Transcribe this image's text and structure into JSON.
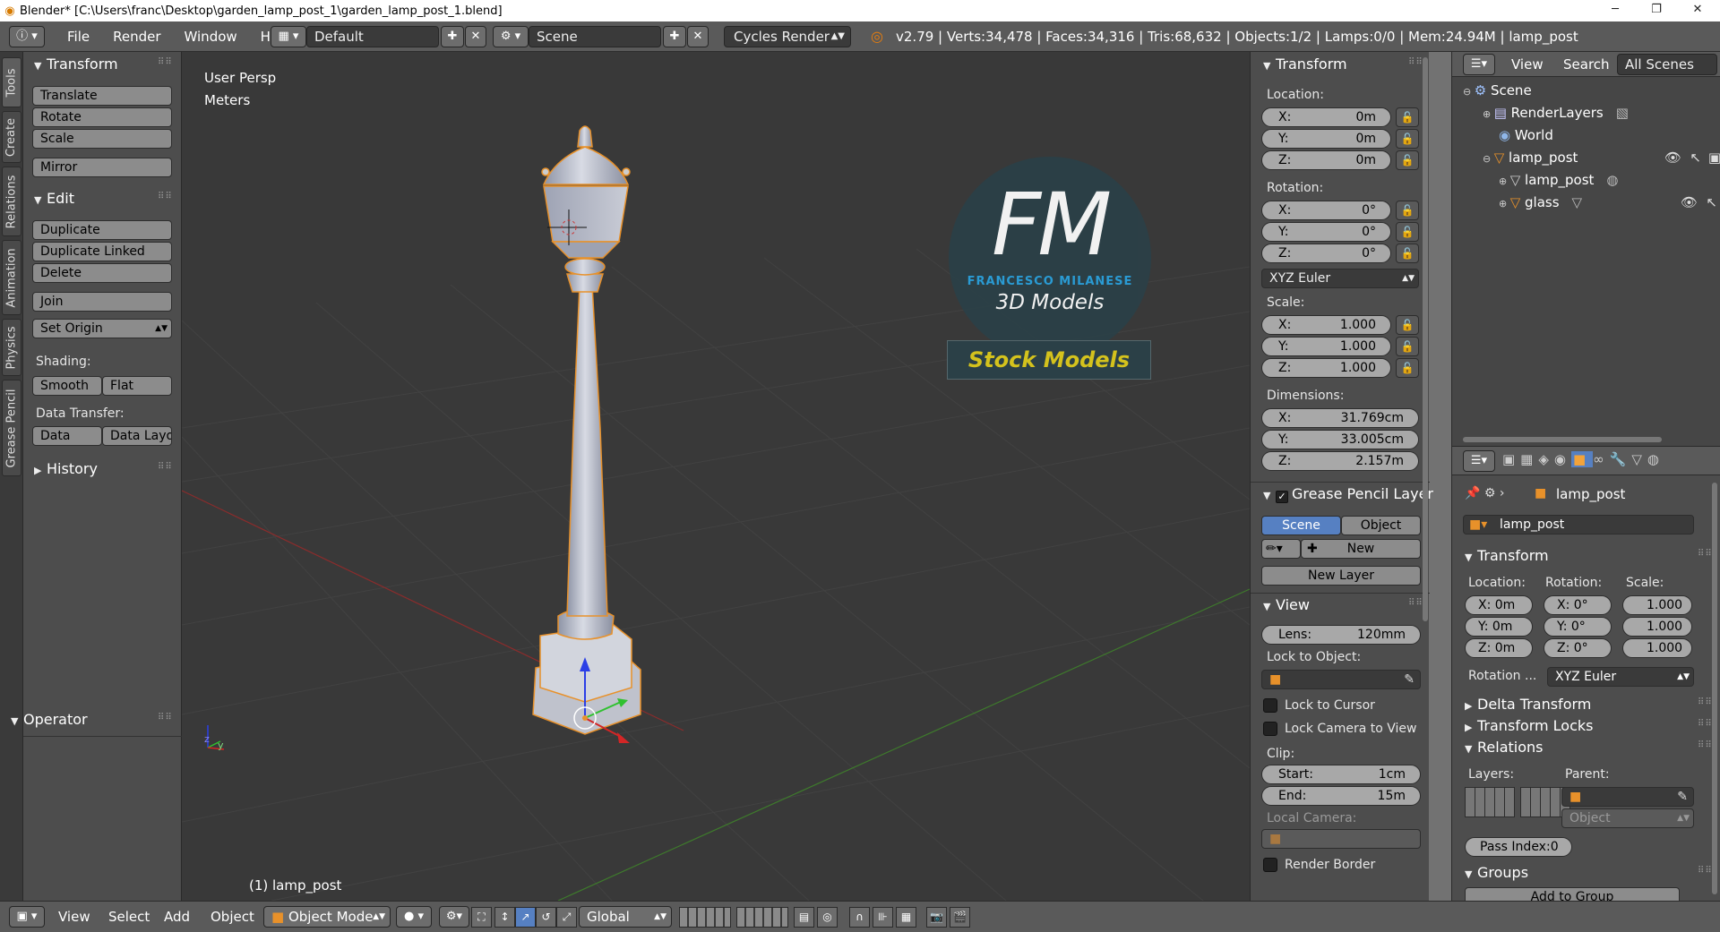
{
  "window": {
    "title": "Blender* [C:\\Users\\franc\\Desktop\\garden_lamp_post_1\\garden_lamp_post_1.blend]",
    "minimize": "─",
    "maximize": "❐",
    "close": "✕"
  },
  "header": {
    "menus": [
      "File",
      "Render",
      "Window",
      "Help"
    ],
    "layout": "Default",
    "scene": "Scene",
    "engine": "Cycles Render",
    "stats": "v2.79 | Verts:34,478 | Faces:34,316 | Tris:68,632 | Objects:1/2 | Lamps:0/0 | Mem:24.94M | lamp_post"
  },
  "tool_tabs": [
    "Tools",
    "Create",
    "Relations",
    "Animation",
    "Physics",
    "Grease Pencil"
  ],
  "tool_shelf": {
    "transform_title": "Transform",
    "translate": "Translate",
    "rotate": "Rotate",
    "scale": "Scale",
    "mirror": "Mirror",
    "edit_title": "Edit",
    "duplicate": "Duplicate",
    "duplicate_linked": "Duplicate Linked",
    "delete": "Delete",
    "join": "Join",
    "set_origin": "Set Origin",
    "shading_label": "Shading:",
    "smooth": "Smooth",
    "flat": "Flat",
    "data_transfer_label": "Data Transfer:",
    "data": "Data",
    "data_layo": "Data Layo",
    "history_title": "History",
    "operator_title": "Operator"
  },
  "viewport": {
    "view_name": "User Persp",
    "units": "Meters",
    "object_label": "(1) lamp_post",
    "watermark": {
      "monogram": "FM",
      "name": "FRANCESCO MILANESE",
      "tagline": "3D Models",
      "banner": "Stock Models"
    }
  },
  "n_panel": {
    "transform_title": "Transform",
    "location_label": "Location:",
    "location": {
      "x": "0m",
      "y": "0m",
      "z": "0m"
    },
    "rotation_label": "Rotation:",
    "rotation": {
      "x": "0°",
      "y": "0°",
      "z": "0°"
    },
    "rotation_mode": "XYZ Euler",
    "scale_label": "Scale:",
    "scale": {
      "x": "1.000",
      "y": "1.000",
      "z": "1.000"
    },
    "dimensions_label": "Dimensions:",
    "dimensions": {
      "x": "31.769cm",
      "y": "33.005cm",
      "z": "2.157m"
    },
    "axis": {
      "x": "X:",
      "y": "Y:",
      "z": "Z:"
    },
    "grease_title": "Grease Pencil Layer",
    "scene_tab": "Scene",
    "object_tab": "Object",
    "new": "New",
    "new_layer": "New Layer",
    "view_title": "View",
    "lens_label": "Lens:",
    "lens_value": "120mm",
    "lock_to_object": "Lock to Object:",
    "lock_cursor": "Lock to Cursor",
    "lock_camera": "Lock Camera to View",
    "clip_label": "Clip:",
    "start_label": "Start:",
    "start_value": "1cm",
    "end_label": "End:",
    "end_value": "15m",
    "local_camera": "Local Camera:",
    "render_border": "Render Border"
  },
  "outliner": {
    "view": "View",
    "search": "Search",
    "filter": "All Scenes",
    "items": [
      "Scene",
      "RenderLayers",
      "World",
      "lamp_post",
      "lamp_post",
      "glass"
    ]
  },
  "properties": {
    "context_name": "lamp_post",
    "object_name": "lamp_post",
    "transform_title": "Transform",
    "location_label": "Location:",
    "rotation_label": "Rotation:",
    "scale_label": "Scale:",
    "loc": [
      "X: 0m",
      "Y: 0m",
      "Z: 0m"
    ],
    "rot": [
      "X:  0°",
      "Y:  0°",
      "Z:  0°"
    ],
    "scl": [
      "1.000",
      "1.000",
      "1.000"
    ],
    "rotation_mode_label": "Rotation ...",
    "rotation_mode": "XYZ Euler",
    "delta_transform": "Delta Transform",
    "transform_locks": "Transform Locks",
    "relations": "Relations",
    "layers_label": "Layers:",
    "parent_label": "Parent:",
    "parent_type": "Object",
    "pass_index": "Pass Index:0",
    "groups": "Groups",
    "add_to_group": "Add to Group"
  },
  "bottom_bar": {
    "view": "View",
    "select": "Select",
    "add": "Add",
    "object": "Object",
    "mode": "Object Mode",
    "orientation": "Global"
  },
  "colors": {
    "selection_outline": "#e8912a",
    "accent_blue": "#5680c2",
    "fm_blue": "#29a3e0",
    "stock_yellow": "#d4c21d"
  }
}
